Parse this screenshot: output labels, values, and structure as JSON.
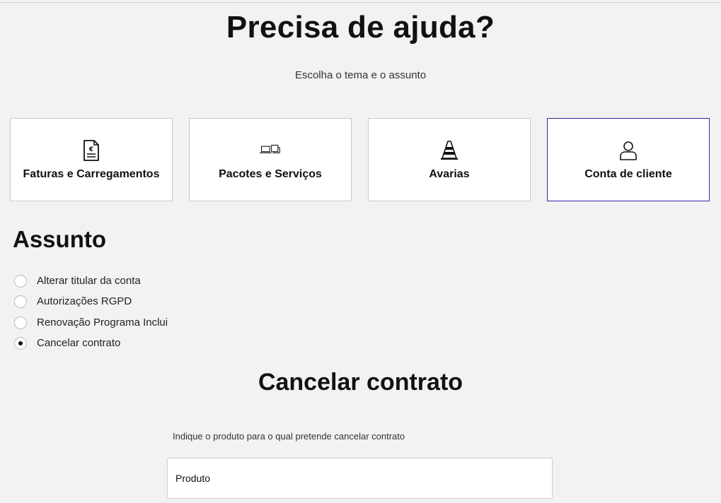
{
  "header": {
    "title": "Precisa de ajuda?",
    "subtitle": "Escolha o tema e o assunto"
  },
  "topics": [
    {
      "label": "Faturas e Carregamentos",
      "icon": "invoice-euro-icon",
      "selected": false
    },
    {
      "label": "Pacotes e Serviços",
      "icon": "devices-icon",
      "selected": false
    },
    {
      "label": "Avarias",
      "icon": "traffic-cone-icon",
      "selected": false
    },
    {
      "label": "Conta de cliente",
      "icon": "user-icon",
      "selected": true
    }
  ],
  "subject": {
    "title": "Assunto",
    "options": [
      {
        "label": "Alterar titular da conta",
        "checked": false
      },
      {
        "label": "Autorizações RGPD",
        "checked": false
      },
      {
        "label": "Renovação Programa Inclui",
        "checked": false
      },
      {
        "label": "Cancelar contrato",
        "checked": true
      }
    ]
  },
  "form": {
    "title": "Cancelar contrato",
    "hint": "Indique o produto para o qual pretende cancelar contrato",
    "product_placeholder": "Produto"
  },
  "colors": {
    "selected_border": "#2b2aa6",
    "background": "#f2f2f2"
  }
}
